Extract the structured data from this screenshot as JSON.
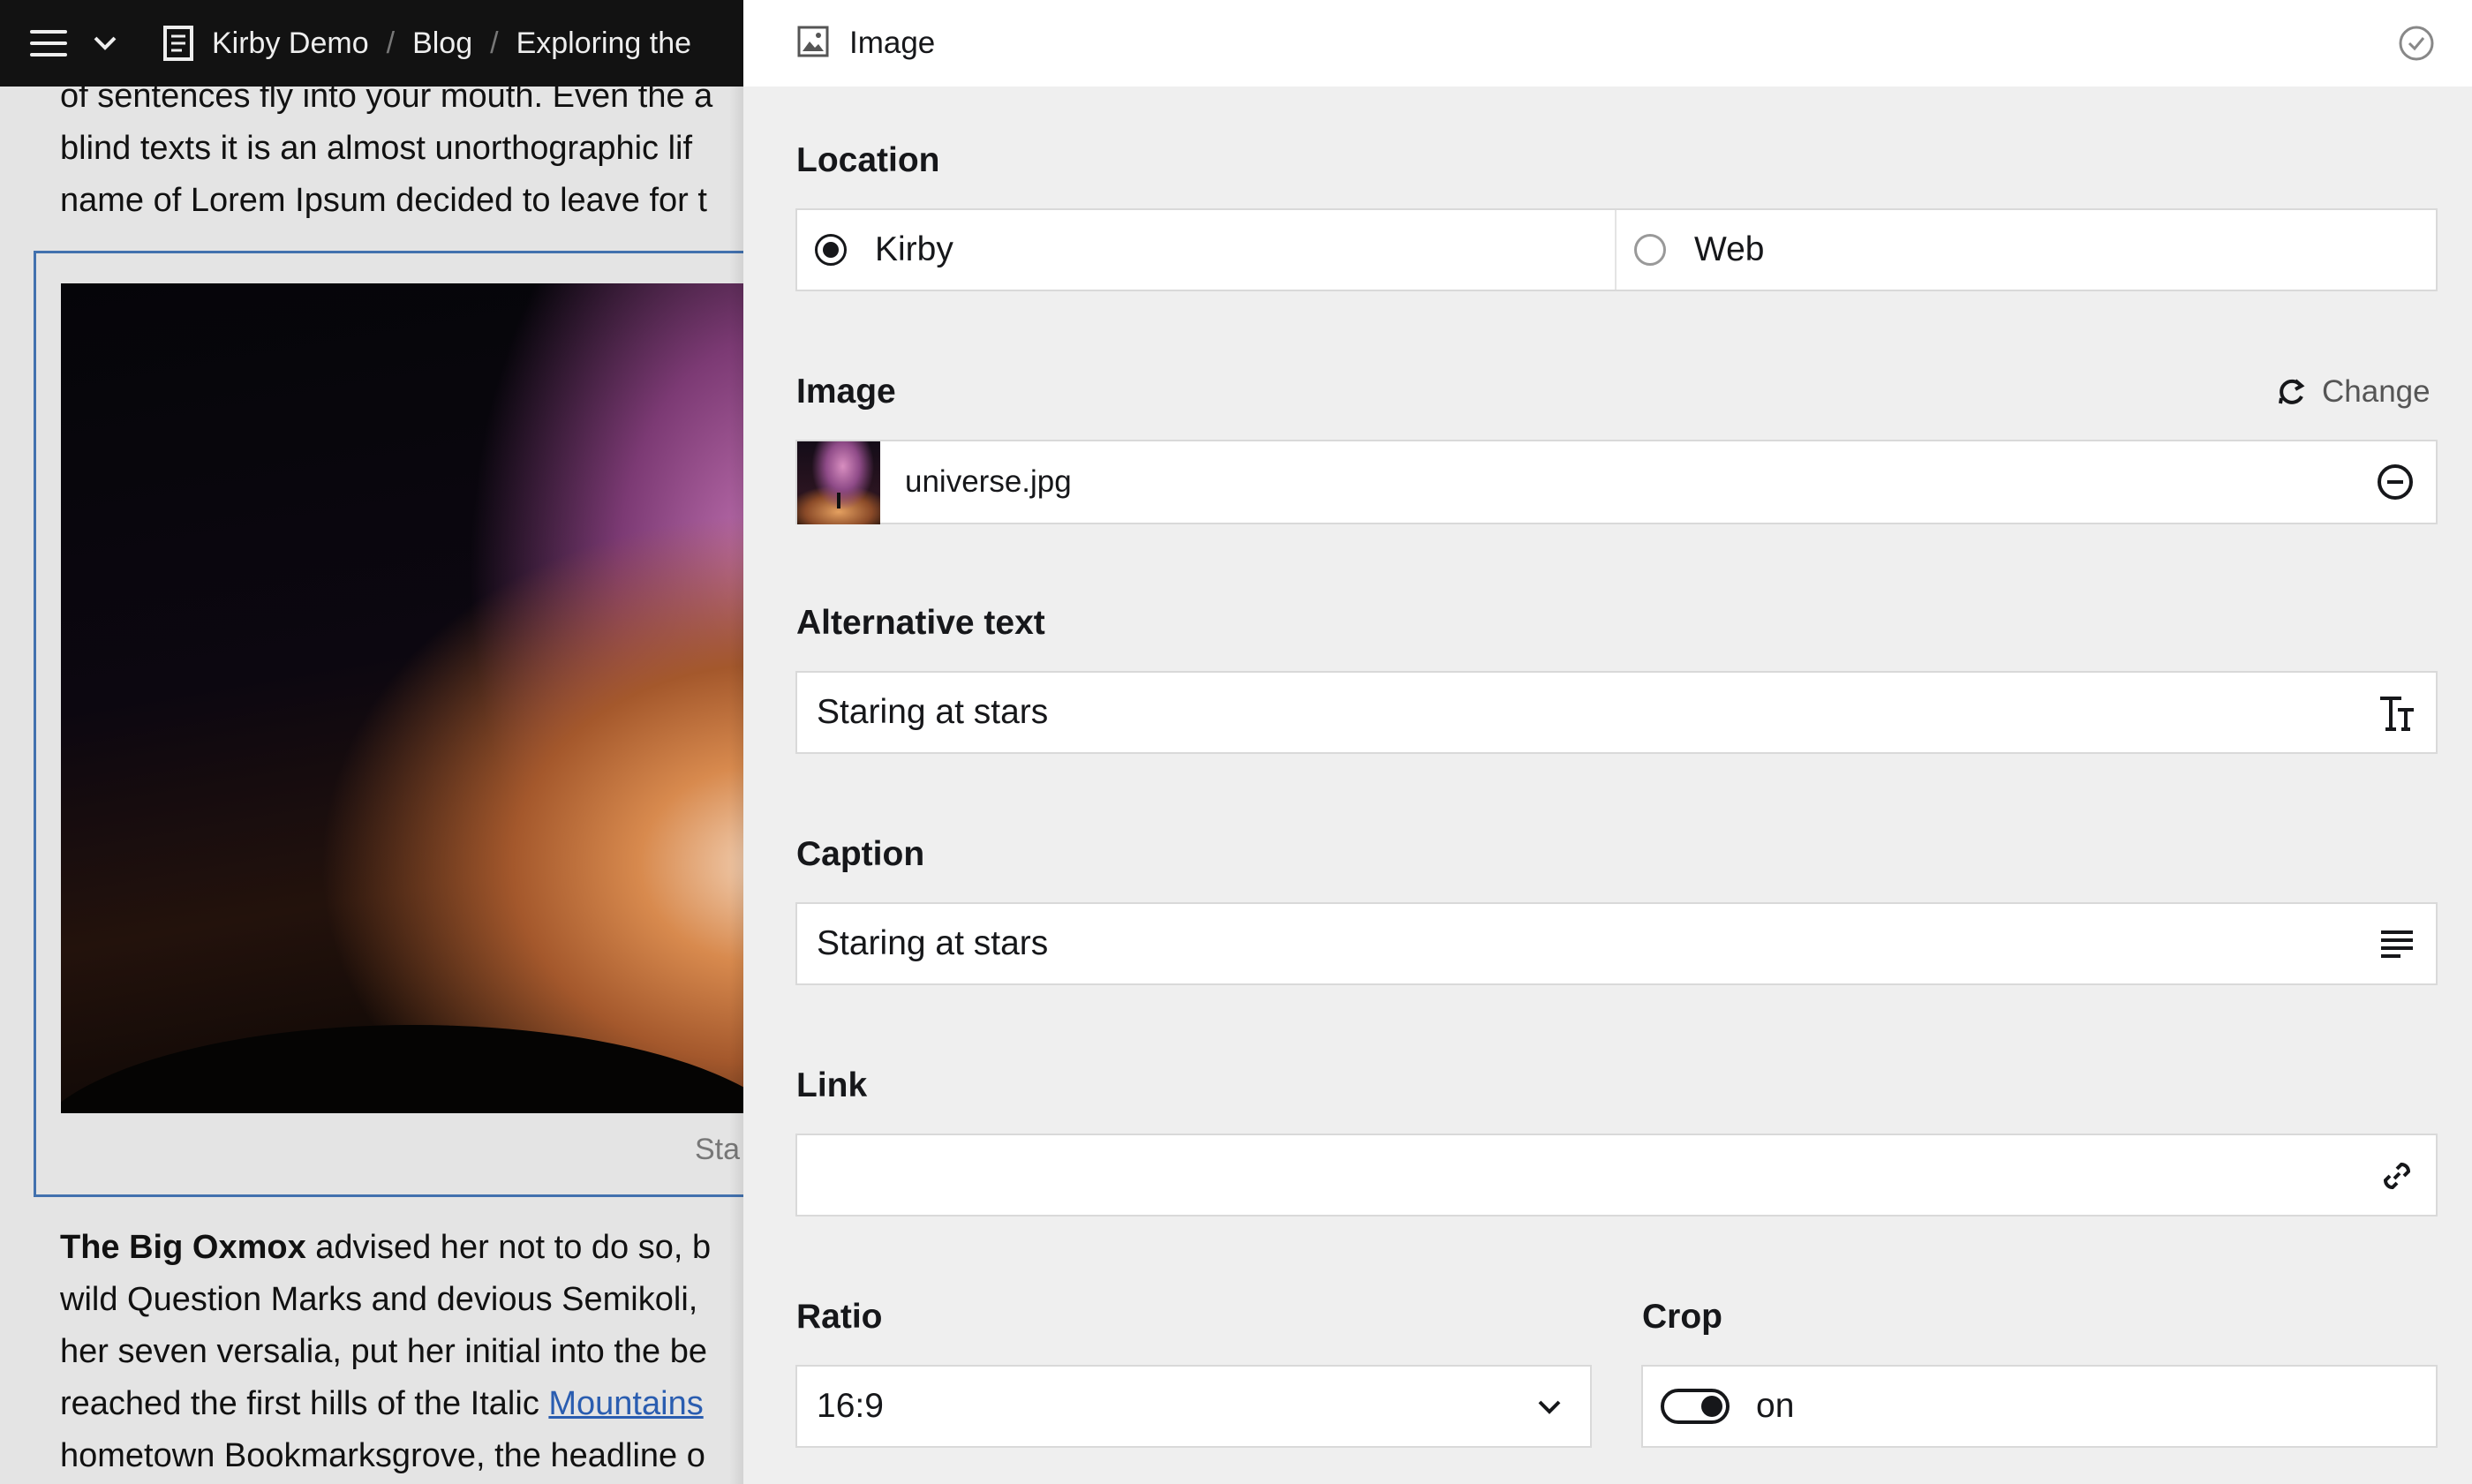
{
  "topbar": {
    "breadcrumb": [
      "Kirby Demo",
      "Blog",
      "Exploring the"
    ],
    "separator": "/"
  },
  "document": {
    "paragraph_top": [
      "of sentences fly into your mouth. Even the a",
      "blind texts it is an almost unorthographic lif",
      "name of Lorem Ipsum decided to leave for t"
    ],
    "image_caption_peek": "Sta",
    "paragraph_bottom": {
      "bold_lead": "The Big Oxmox",
      "line1_rest": " advised her not to do so, b",
      "line2": "wild Question Marks and devious Semikoli,",
      "line3": "her seven versalia, put her initial into the be",
      "line4_start": "reached the first hills of the Italic ",
      "line4_link": "Mountains",
      "line5": "hometown Bookmarksgrove, the headline o"
    }
  },
  "drawer": {
    "title": "Image",
    "icons": {
      "title": "image-icon",
      "done": "check-circle-icon"
    },
    "location": {
      "label": "Location",
      "options": [
        "Kirby",
        "Web"
      ],
      "selected": "Kirby"
    },
    "image": {
      "label": "Image",
      "change_label": "Change",
      "filename": "universe.jpg"
    },
    "alt": {
      "label": "Alternative text",
      "value": "Staring at stars"
    },
    "caption": {
      "label": "Caption",
      "value": "Staring at stars"
    },
    "link": {
      "label": "Link",
      "value": ""
    },
    "ratio": {
      "label": "Ratio",
      "value": "16:9"
    },
    "crop": {
      "label": "Crop",
      "value": "on",
      "enabled": true
    }
  }
}
